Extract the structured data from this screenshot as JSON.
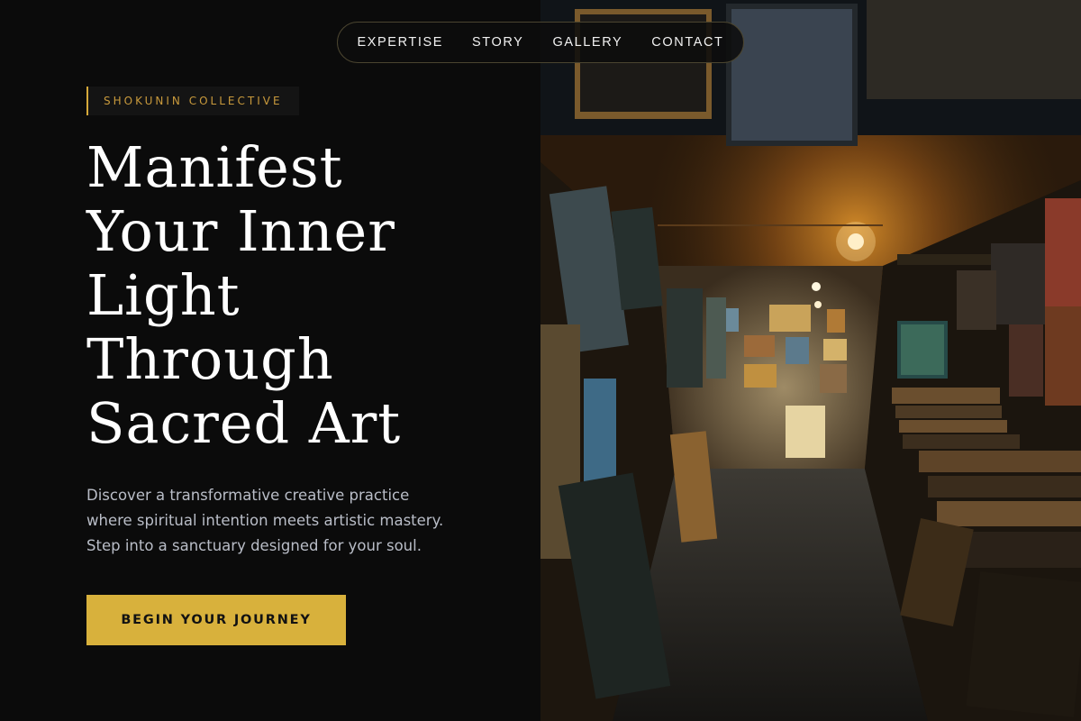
{
  "nav": {
    "items": [
      {
        "label": "EXPERTISE"
      },
      {
        "label": "STORY"
      },
      {
        "label": "GALLERY"
      },
      {
        "label": "CONTACT"
      }
    ]
  },
  "hero": {
    "badge": "SHOKUNIN COLLECTIVE",
    "headline_lines": [
      "Manifest",
      "Your Inner",
      "Light",
      "Through",
      "Sacred Art"
    ],
    "description_lines": [
      "Discover a transformative creative practice",
      "where spiritual intention meets artistic mastery.",
      "Step into a sanctuary designed for your soul."
    ],
    "cta_label": "BEGIN YOUR JOURNEY"
  },
  "colors": {
    "background": "#0b0b0b",
    "accent_gold": "#d8b13c",
    "badge_text": "#c99a3c",
    "body_text": "#b9bdc7"
  }
}
